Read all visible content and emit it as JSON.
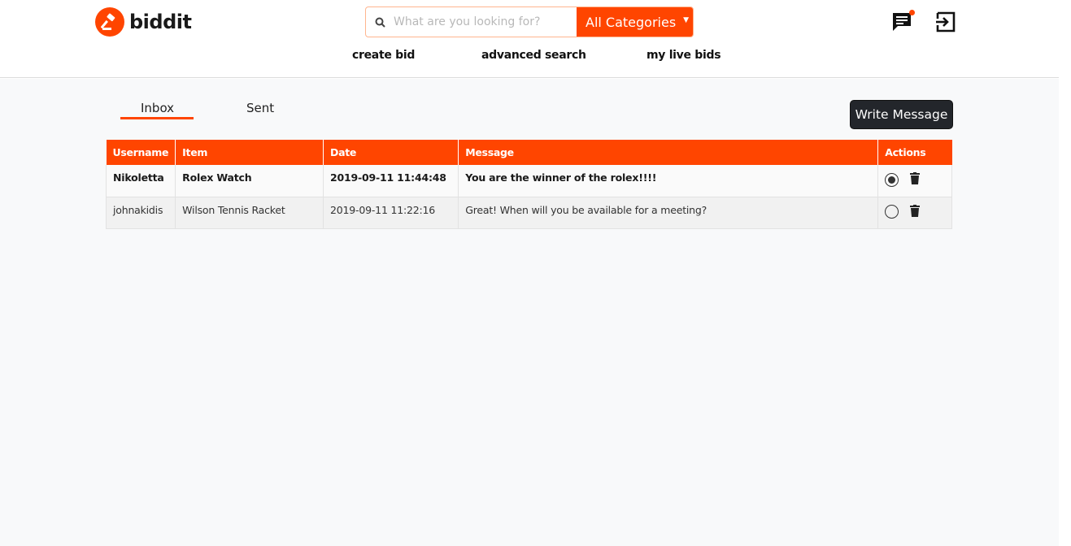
{
  "brand": {
    "name": "biddit",
    "accent": "#ff4500"
  },
  "search": {
    "placeholder": "What are you looking for?",
    "category": "All Categories"
  },
  "nav": {
    "create_bid": "create bid",
    "advanced_search": "advanced search",
    "my_live_bids": "my live bids"
  },
  "header_icons": [
    "message-icon",
    "logout-icon"
  ],
  "tabs": {
    "inbox": "Inbox",
    "sent": "Sent",
    "active": "Inbox"
  },
  "write_button": "Write Message",
  "table": {
    "headers": [
      "Username",
      "Item",
      "Date",
      "Message",
      "Actions"
    ],
    "rows": [
      {
        "username": "Nikoletta",
        "item": "Rolex Watch",
        "date": "2019-09-11 11:44:48",
        "message": "You are the winner of the rolex!!!!",
        "read": false
      },
      {
        "username": "johnakidis",
        "item": "Wilson Tennis Racket",
        "date": "2019-09-11 11:22:16",
        "message": "Great! When will you be available for a meeting?",
        "read": true
      }
    ]
  }
}
